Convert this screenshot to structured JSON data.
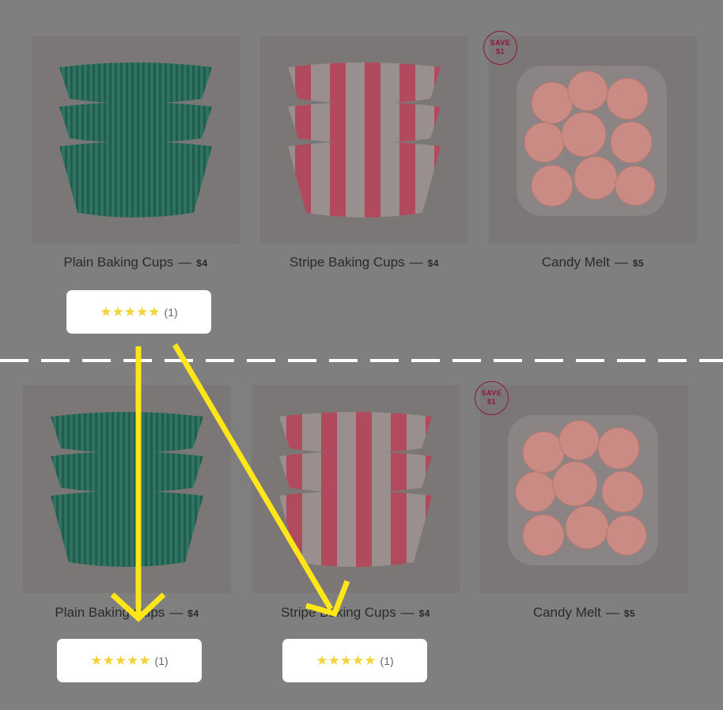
{
  "before": {
    "products": [
      {
        "title": "Plain Baking Cups",
        "dash": "—",
        "price": "$4"
      },
      {
        "title": "Stripe Baking Cups",
        "dash": "—",
        "price": "$4"
      },
      {
        "title": "Candy Melt",
        "dash": "—",
        "price": "$5"
      }
    ],
    "badge": {
      "line1": "SAVE",
      "line2": "$1"
    },
    "rating": {
      "stars": "★★★★★",
      "count": "(1)"
    }
  },
  "after": {
    "products": [
      {
        "title": "Plain Baking Cups",
        "dash": "—",
        "price": "$4"
      },
      {
        "title": "Stripe Baking Cups",
        "dash": "—",
        "price": "$4"
      },
      {
        "title": "Candy Melt",
        "dash": "—",
        "price": "$5"
      }
    ],
    "badge": {
      "line1": "SAVE",
      "line2": "$1"
    },
    "ratings": [
      {
        "stars": "★★★★★",
        "count": "(1)"
      },
      {
        "stars": "★★★★★",
        "count": "(1)"
      }
    ]
  },
  "colors": {
    "overlay": "#7f7f7f",
    "arrow": "#ffe619",
    "star": "#f2d33a",
    "badge": "#8e1440",
    "teal_cup": "#2a6b5a",
    "pink_stripe": "#c95468"
  }
}
